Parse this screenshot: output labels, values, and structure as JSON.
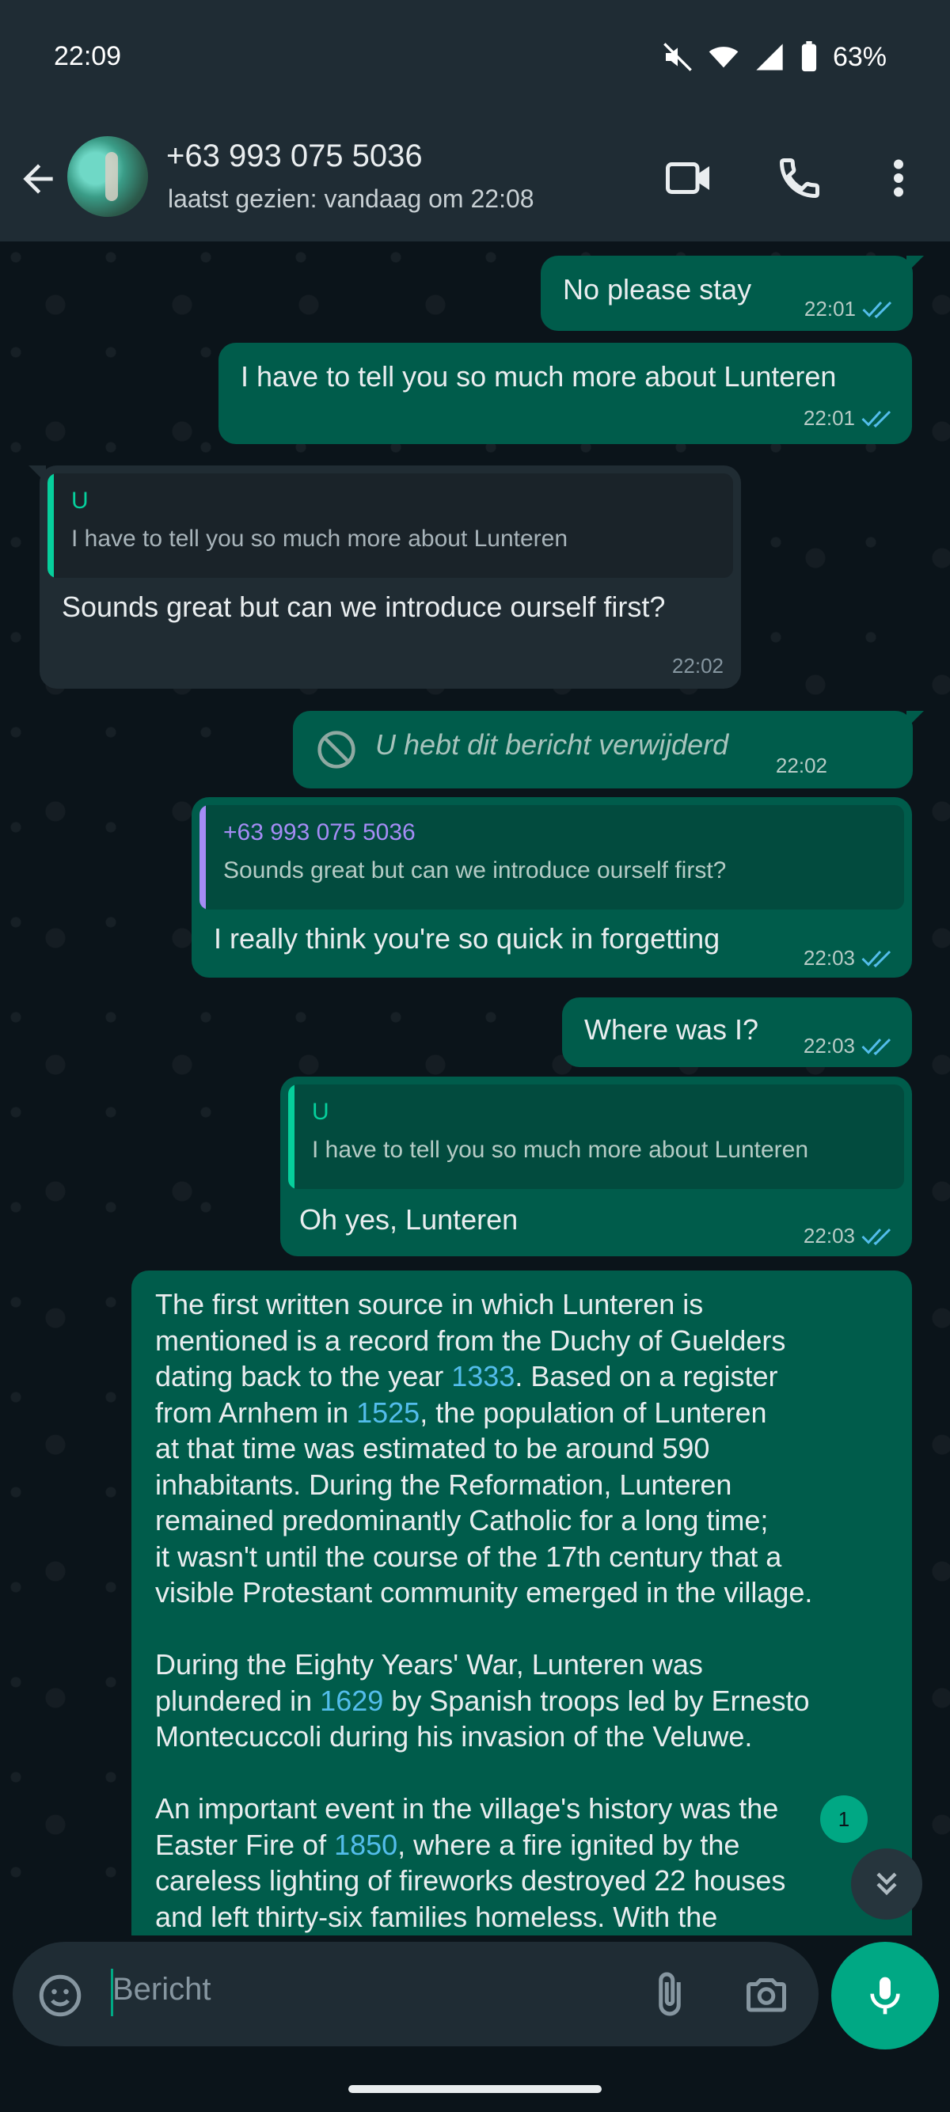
{
  "status_bar": {
    "time": "22:09",
    "battery": "63%"
  },
  "header": {
    "contact_name": "+63 993 075 5036",
    "last_seen": "laatst gezien: vandaag om 22:08",
    "icons": [
      "back-arrow-icon",
      "avatar",
      "video-call-icon",
      "phone-icon",
      "more-vert-icon"
    ]
  },
  "messages": [
    {
      "dir": "out",
      "text": "No please stay",
      "time": "22:01",
      "status": "read"
    },
    {
      "dir": "out",
      "text": "I have to tell you so much more about Lunteren",
      "time": "22:01",
      "status": "read"
    },
    {
      "dir": "in",
      "quote_author": "U",
      "quote_text": "I have to tell you so much more about Lunteren",
      "text": "Sounds great but can we introduce ourself first?",
      "time": "22:02"
    },
    {
      "dir": "out",
      "deleted": true,
      "text": "U hebt dit bericht verwijderd",
      "time": "22:02"
    },
    {
      "dir": "out",
      "quote_author": "+63 993 075 5036",
      "quote_text": "Sounds great but can we introduce ourself first?",
      "text": "I really think you're so quick in forgetting",
      "time": "22:03",
      "status": "read"
    },
    {
      "dir": "out",
      "text": "Where was I?",
      "time": "22:03",
      "status": "read"
    },
    {
      "dir": "out",
      "quote_author": "U",
      "quote_text": "I have to tell you so much more about Lunteren",
      "text": "Oh yes, Lunteren",
      "time": "22:03",
      "status": "read"
    }
  ],
  "long_message": {
    "p1": {
      "a": "The first written source in which Lunteren is\nmentioned is a record from the Duchy of Guelders\ndating back to the year ",
      "y1": "1333",
      "b": ". Based on a register\nfrom Arnhem in ",
      "y2": "1525",
      "c": ", the population of Lunteren\nat that time was estimated to be around 590\ninhabitants. During the Reformation, Lunteren\nremained predominantly Catholic for a long time;\nit wasn't until the course of the 17th century that a\nvisible Protestant community emerged in the village."
    },
    "p2": {
      "a": "During the Eighty Years' War, Lunteren was\nplundered in ",
      "y1": "1629",
      "b": " by Spanish troops led by Ernesto\nMontecuccoli during his invasion of the Veluwe."
    },
    "p3": {
      "a": "An important event in the village's history was the\nEaster Fire of ",
      "y1": "1850",
      "b": ", where a fire ignited by the\ncareless lighting of fireworks destroyed 22 houses\nand left thirty-six families homeless. With the"
    }
  },
  "unread_count": "1",
  "composer": {
    "placeholder": "Bericht"
  },
  "colors": {
    "outgoing": "#005c4b",
    "incoming": "#202c33",
    "accent": "#00a884",
    "link": "#53bdeb",
    "read_tick": "#53bdeb"
  }
}
